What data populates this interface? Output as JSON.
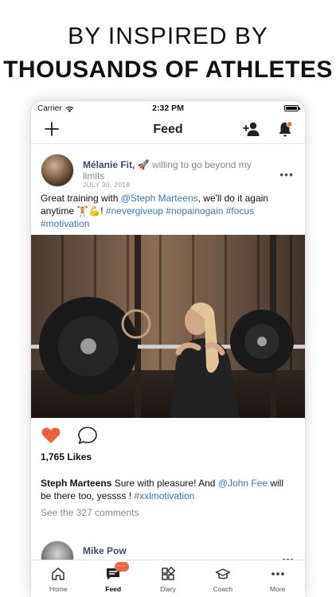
{
  "headline": {
    "line1": "BY INSPIRED BY",
    "line2": "THOUSANDS OF ATHLETES"
  },
  "status_bar": {
    "carrier": "Carrier",
    "time": "2:32 PM"
  },
  "nav": {
    "title": "Feed"
  },
  "post": {
    "author": "Mélanie Fit,",
    "status_emoji": "🚀",
    "status_text": " willing to go beyond my limits",
    "date": "JULY 30, 2018",
    "caption_prefix": "Great training with ",
    "mention": "@Steph Marteens",
    "caption_middle": ", we'll do it again anytime ",
    "caption_emojis": "🏋💪",
    "caption_bang": "! ",
    "hashtags": "#nevergiveup #nopainogain #focus #motivation",
    "likes": "1,765 Likes",
    "comment": {
      "name": "Steph Marteens",
      "text_before": " Sure with pleasure! And ",
      "mention": "@John Fee",
      "text_after": " will be there too, yessss ! ",
      "hashtag": "#xxlmotivation"
    },
    "see_comments": "See the 327 comments"
  },
  "post2": {
    "author": "Mike Pow"
  },
  "tabs": [
    {
      "label": "Home",
      "icon": "home-icon"
    },
    {
      "label": "Feed",
      "icon": "feed-icon",
      "badge": "···"
    },
    {
      "label": "Diary",
      "icon": "diary-icon"
    },
    {
      "label": "Coach",
      "icon": "coach-icon"
    },
    {
      "label": "More",
      "icon": "more-icon"
    }
  ],
  "colors": {
    "accent": "#f0643c",
    "link": "#3a78b8",
    "name": "#3a4d6b"
  }
}
